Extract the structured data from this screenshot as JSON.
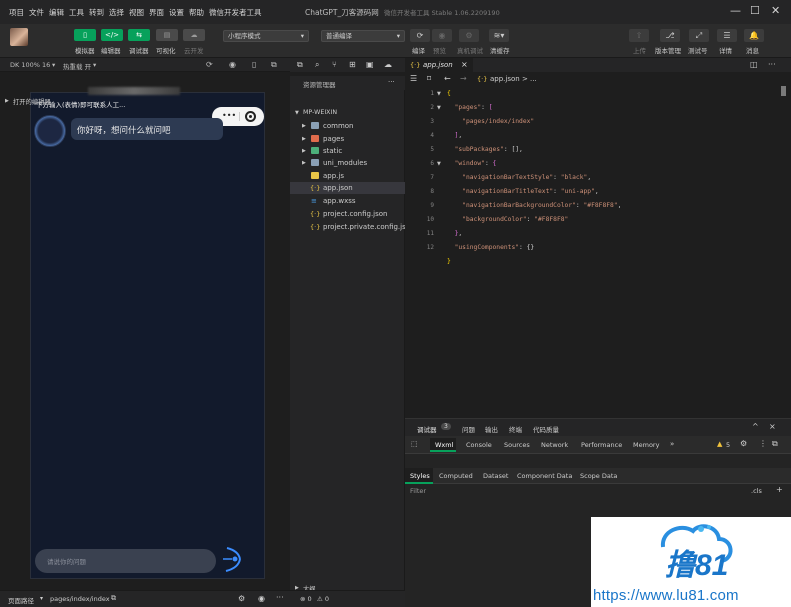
{
  "menubar": {
    "items": [
      "项目",
      "文件",
      "编辑",
      "工具",
      "转到",
      "选择",
      "视图",
      "界面",
      "设置",
      "帮助",
      "微信开发者工具"
    ],
    "title": "ChatGPT_刀客源码网",
    "version": "微信开发者工具 Stable 1.06.2209190",
    "minimize": "—",
    "maximize": "☐",
    "close": "✕"
  },
  "toolbar": {
    "simulator_label": "模拟器",
    "editor_label": "编辑器",
    "debugger_label": "调试器",
    "visual_label": "可视化",
    "cloud_label": "云开发",
    "mode_select": "小程序模式",
    "compile_select": "普通编译",
    "compile_label": "编译",
    "preview_label": "预览",
    "realdebug_label": "真机调试",
    "clearcache_label": "清缓存",
    "upload_label": "上传",
    "version_label": "版本管理",
    "test_label": "测试号",
    "detail_label": "详情",
    "message_label": "消息"
  },
  "simulator": {
    "device": "DK 100% 16",
    "hotreload": "热重载 开",
    "notice": "下方输入(表情)即可联系人工...",
    "bot_message": "你好呀，想问什么就问吧",
    "input_placeholder": "请说你的问题"
  },
  "explorer": {
    "header": "资源管理器",
    "open_editors": "打开的编辑器",
    "project": "MP-WEIXIN",
    "more": "···",
    "items": [
      {
        "label": "common",
        "type": "folder"
      },
      {
        "label": "pages",
        "type": "folder"
      },
      {
        "label": "static",
        "type": "folder"
      },
      {
        "label": "uni_modules",
        "type": "folder"
      },
      {
        "label": "app.js",
        "type": "js"
      },
      {
        "label": "app.json",
        "type": "json"
      },
      {
        "label": "app.wxss",
        "type": "wxss"
      },
      {
        "label": "project.config.json",
        "type": "json"
      },
      {
        "label": "project.private.config.js...",
        "type": "json"
      }
    ],
    "outline": "大纲"
  },
  "editor": {
    "tab_label": "app.json",
    "breadcrumb": "app.json > ...",
    "line_numbers": [
      "1",
      "2",
      "3",
      "4",
      "5",
      "6",
      "7",
      "8",
      "9",
      "10",
      "11",
      "12"
    ]
  },
  "debug": {
    "panel_title": "调试器",
    "panel_count": "3",
    "panel_tabs": [
      "问题",
      "输出",
      "终端",
      "代码质量"
    ],
    "tabs": [
      "Wxml",
      "Console",
      "Sources",
      "Network",
      "Performance",
      "Memory",
      "»"
    ],
    "warning_count": "5",
    "styles_tabs": [
      "Styles",
      "Computed",
      "Dataset",
      "Component Data",
      "Scope Data"
    ],
    "filter_placeholder": "Filter",
    "cls": ".cls",
    "plus": "+"
  },
  "statusbar": {
    "page_path_label": "页面路径",
    "page_path": "pages/index/index",
    "errors": "⊗ 0",
    "warnings": "⚠ 0"
  },
  "watermark": {
    "brand": "撸81",
    "url": "https://www.lu81.com",
    "color": "#1a76c9"
  }
}
